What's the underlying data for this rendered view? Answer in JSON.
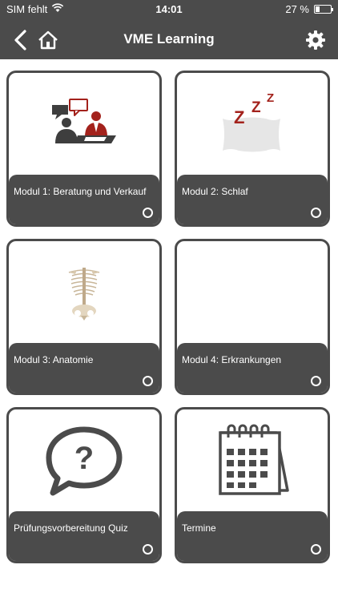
{
  "status_bar": {
    "carrier": "SIM fehlt",
    "time": "14:01",
    "battery": "27 %"
  },
  "nav": {
    "title": "VME Learning"
  },
  "tiles": [
    {
      "label": "Modul 1: Beratung und Verkauf",
      "icon": "consultation-icon"
    },
    {
      "label": "Modul 2: Schlaf",
      "icon": "sleep-pillow-icon"
    },
    {
      "label": "Modul 3: Anatomie",
      "icon": "skeleton-icon"
    },
    {
      "label": "Modul 4: Erkrankungen",
      "icon": ""
    },
    {
      "label": "Prüfungsvorbereitung Quiz",
      "icon": "question-bubble-icon"
    },
    {
      "label": "Termine",
      "icon": "calendar-icon"
    }
  ],
  "colors": {
    "bar": "#4b4b4b",
    "accent_red": "#a3221c"
  }
}
